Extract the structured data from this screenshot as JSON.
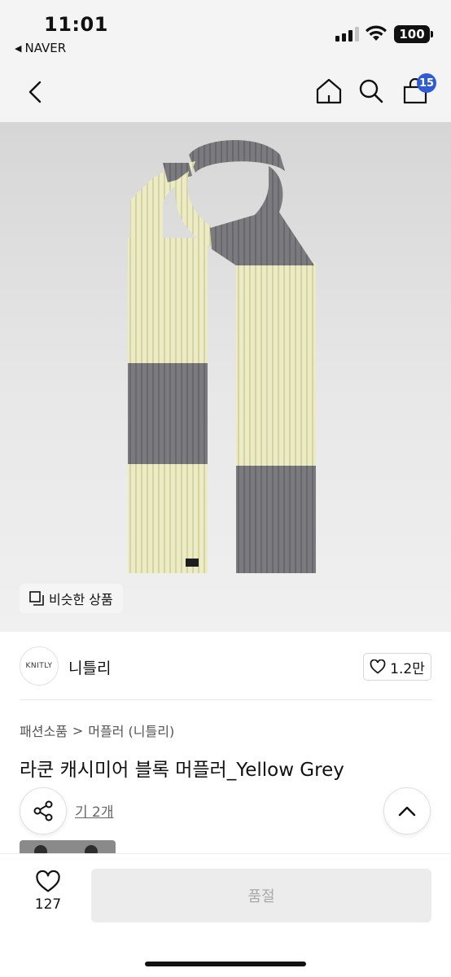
{
  "status_bar": {
    "time": "11:01",
    "back_app": "NAVER",
    "battery": "100",
    "icons": [
      "signal-icon",
      "wifi-icon",
      "battery-icon"
    ]
  },
  "nav": {
    "icons": [
      "back-arrow-icon",
      "home-icon",
      "search-icon",
      "shopping-bag-icon"
    ],
    "cart_count": "15",
    "badge_color": "#2f5bd3"
  },
  "product_image": {
    "similar_label": "비슷한 상품",
    "similar_icon": "similar-items-icon",
    "colors": {
      "yellow": "#ecebc2",
      "grey": "#7a7a7d"
    }
  },
  "seller": {
    "logo_text": "KNITLY",
    "name": "니틀리",
    "like_count": "1.2만",
    "like_icon": "heart-icon"
  },
  "product": {
    "breadcrumb": [
      "패션소품",
      "머플러 (니틀리)"
    ],
    "breadcrumb_separator": ">",
    "title": "라쿤 캐시미어 블록 머플러_Yellow Grey",
    "review_link": "기 2개"
  },
  "floating": {
    "share_icon": "share-icon",
    "scroll_top_icon": "chevron-up-icon"
  },
  "bottom_bar": {
    "wish_icon": "heart-icon",
    "wish_count": "127",
    "soldout_label": "품절"
  }
}
